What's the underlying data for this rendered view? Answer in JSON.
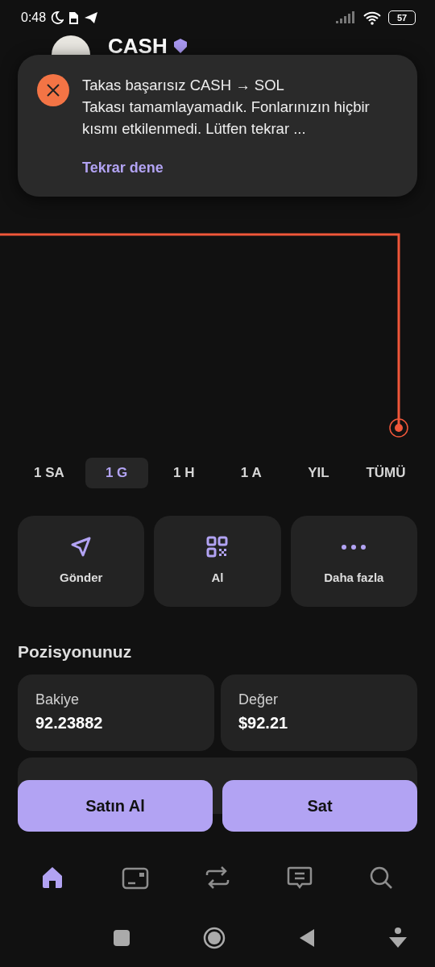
{
  "status_bar": {
    "time": "0:48",
    "battery": "57"
  },
  "header": {
    "title": "CASH"
  },
  "toast": {
    "title": "Takas başarısız CASH → SOL",
    "message": "Takası tamamlayamadık. Fonlarınızın hiçbir kısmı etkilenmedi. Lütfen tekrar ...",
    "action": "Tekrar dene"
  },
  "timeframes": [
    {
      "label": "1 SA",
      "selected": false
    },
    {
      "label": "1 G",
      "selected": true
    },
    {
      "label": "1 H",
      "selected": false
    },
    {
      "label": "1 A",
      "selected": false
    },
    {
      "label": "YIL",
      "selected": false
    },
    {
      "label": "TÜMÜ",
      "selected": false
    }
  ],
  "actions": [
    {
      "kind": "send",
      "label": "Gönder"
    },
    {
      "kind": "qr",
      "label": "Al"
    },
    {
      "kind": "more",
      "label": "Daha fazla"
    }
  ],
  "position": {
    "title": "Pozisyonunuz",
    "stats": [
      {
        "label": "Bakiye",
        "value": "92.23882"
      },
      {
        "label": "Değer",
        "value": "$92.21"
      }
    ]
  },
  "trade_buttons": [
    "Satın Al",
    "Sat"
  ],
  "bottom_nav": [
    {
      "kind": "home",
      "selected": true
    },
    {
      "kind": "card",
      "selected": false
    },
    {
      "kind": "swap",
      "selected": false
    },
    {
      "kind": "chat",
      "selected": false
    },
    {
      "kind": "search",
      "selected": false
    }
  ]
}
